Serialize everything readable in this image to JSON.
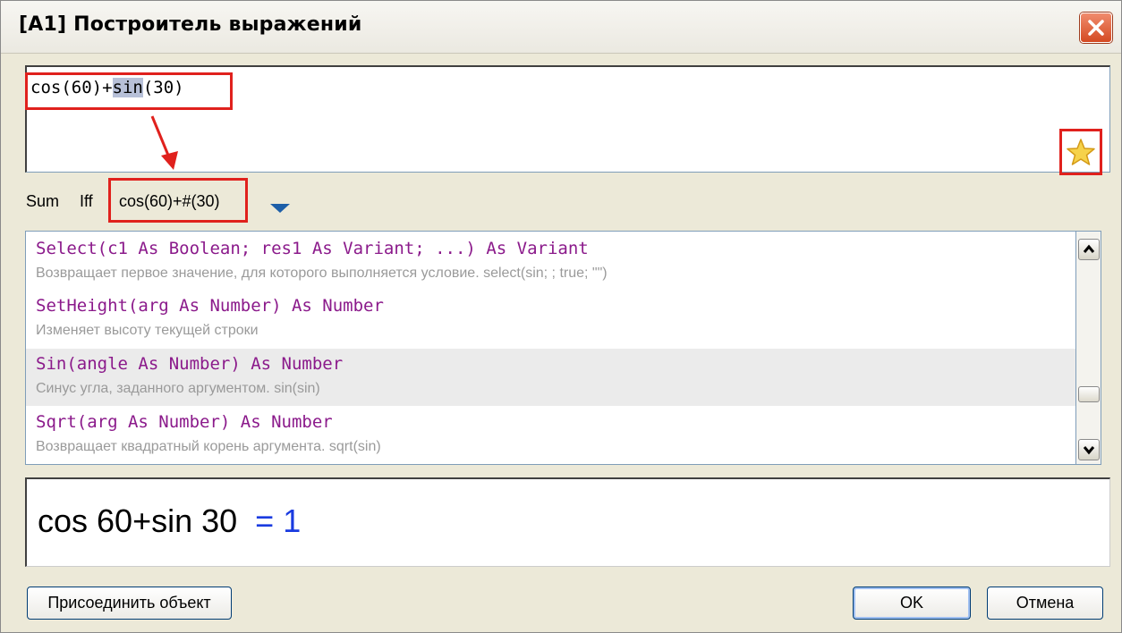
{
  "window": {
    "title": "[A1] Построитель выражений",
    "close_icon": "close-icon"
  },
  "expression": {
    "before_selection": "cos(60)+",
    "selected": "sin",
    "after_selection": "(30)",
    "favorite_icon": "star-icon"
  },
  "toolbar": {
    "items": [
      {
        "label": "Sum"
      },
      {
        "label": "Iff"
      },
      {
        "label": "cos(60)+#(30)"
      }
    ],
    "dropdown_icon": "chevron-down-icon"
  },
  "functions": [
    {
      "signature": "Select(c1 As Boolean; res1 As Variant; ...) As Variant",
      "description": "Возвращает первое значение, для которого выполняется условие. select(sin; ; true; \"\")"
    },
    {
      "signature": "SetHeight(arg As Number) As Number",
      "description": "Изменяет высоту текущей строки"
    },
    {
      "signature": "Sin(angle As Number) As Number",
      "description": "Синус угла, заданного аргументом. sin(sin)",
      "selected": true
    },
    {
      "signature": "Sqrt(arg As Number) As Number",
      "description": "Возвращает квадратный корень аргумента. sqrt(sin)"
    }
  ],
  "result": {
    "expression": "cos 60+sin 30",
    "equals": "= 1"
  },
  "buttons": {
    "attach": "Присоединить объект",
    "ok": "OK",
    "cancel": "Отмена"
  },
  "colors": {
    "highlight_box": "#e0211d",
    "signature": "#8b1a8b",
    "result_value": "#1a3be0"
  }
}
